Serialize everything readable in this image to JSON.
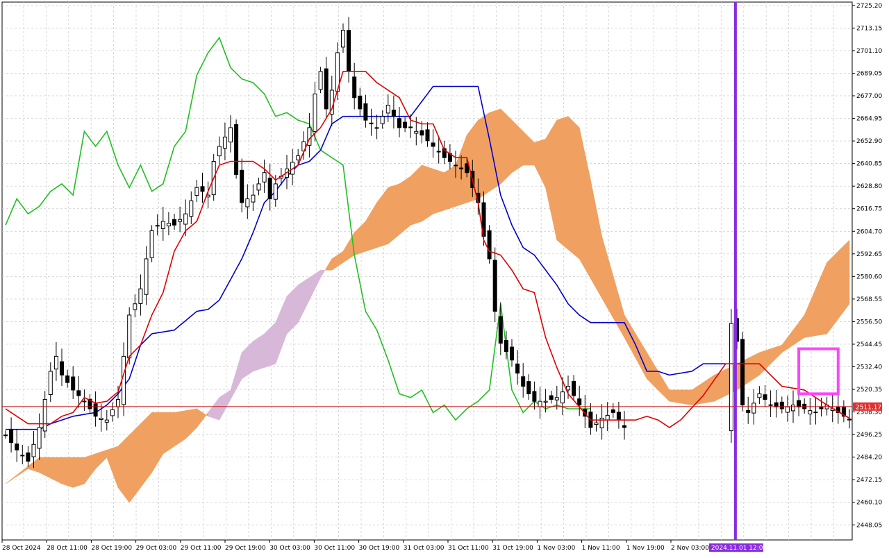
{
  "chart_data": {
    "type": "candlestick",
    "title": "",
    "ylim": [
      2440,
      2727
    ],
    "y_ticks": [
      "2725.20",
      "2713.15",
      "2701.10",
      "2689.05",
      "2677.00",
      "2664.95",
      "2652.90",
      "2640.85",
      "2628.80",
      "2616.75",
      "2604.70",
      "2592.65",
      "2580.60",
      "2568.55",
      "2556.50",
      "2544.45",
      "2532.40",
      "2520.35",
      "2508.30",
      "2496.25",
      "2484.20",
      "2472.15",
      "2460.10",
      "2448.05"
    ],
    "x_ticks": [
      "28 Oct 2024",
      "28 Oct 11:00",
      "28 Oct 19:00",
      "29 Oct 03:00",
      "29 Oct 11:00",
      "29 Oct 19:00",
      "30 Oct 03:00",
      "30 Oct 11:00",
      "30 Oct 19:00",
      "31 Oct 03:00",
      "31 Oct 11:00",
      "31 Oct 19:00",
      "1 Nov 03:00",
      "1 Nov 11:00",
      "1 Nov 19:00",
      "2 Nov 03:00"
    ],
    "current_price": "2511.17",
    "current_price_value": 2511.17,
    "vline_label": "2024.11.01 12:00",
    "vline_index": 129,
    "highlight_box_index_range": [
      141,
      148
    ],
    "highlight_box_value_range": [
      2518,
      2542
    ],
    "colors": {
      "tenkan": "#e00000",
      "kijun": "#0000d0",
      "chikou": "#20c020",
      "kumo_bull": "#f0a060",
      "kumo_bear": "#d8b8d8",
      "vline": "#8a2be2",
      "box": "#ff44ff",
      "price_line": "#c80000",
      "price_label_bg": "#e03030",
      "grid": "#c8c8c8",
      "candle": "#000000"
    },
    "candles": [],
    "tenkan": [],
    "kijun": [],
    "chikou": [],
    "kumo_a": [],
    "kumo_b": []
  }
}
